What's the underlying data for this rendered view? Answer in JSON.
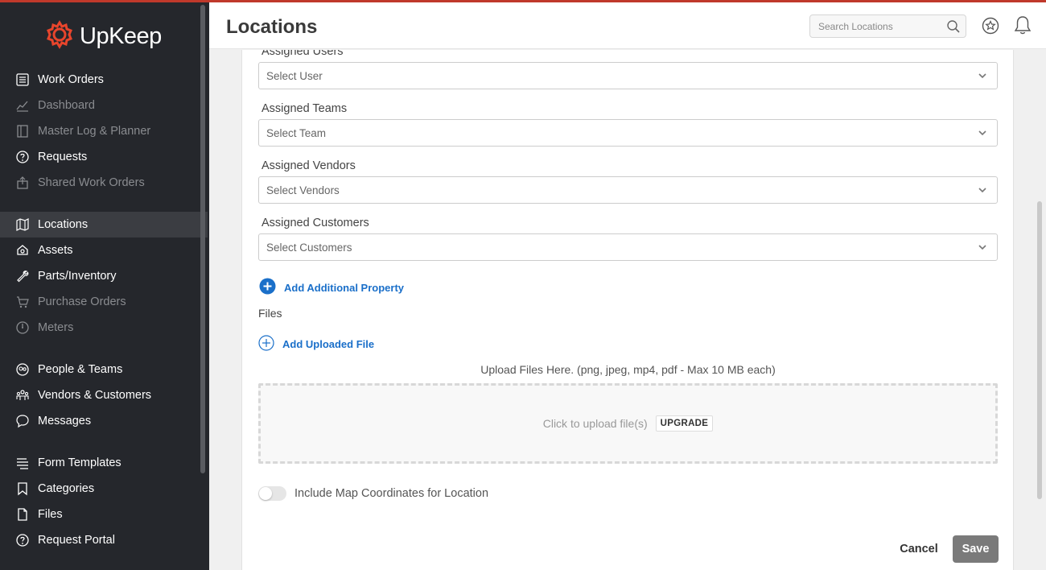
{
  "app": {
    "name": "UpKeep",
    "brand_color": "#e8452c"
  },
  "sidebar": {
    "groups": [
      [
        {
          "label": "Work Orders",
          "icon": "list-icon",
          "dim": false
        },
        {
          "label": "Dashboard",
          "icon": "chart-icon",
          "dim": true
        },
        {
          "label": "Master Log & Planner",
          "icon": "book-icon",
          "dim": true
        },
        {
          "label": "Requests",
          "icon": "question-icon",
          "dim": false
        },
        {
          "label": "Shared Work Orders",
          "icon": "share-icon",
          "dim": true
        }
      ],
      [
        {
          "label": "Locations",
          "icon": "map-icon",
          "dim": false,
          "active": true
        },
        {
          "label": "Assets",
          "icon": "asset-icon",
          "dim": false
        },
        {
          "label": "Parts/Inventory",
          "icon": "wrench-icon",
          "dim": false
        },
        {
          "label": "Purchase Orders",
          "icon": "cart-icon",
          "dim": true
        },
        {
          "label": "Meters",
          "icon": "meter-icon",
          "dim": true
        }
      ],
      [
        {
          "label": "People & Teams",
          "icon": "people-icon",
          "dim": false
        },
        {
          "label": "Vendors & Customers",
          "icon": "vendors-icon",
          "dim": false
        },
        {
          "label": "Messages",
          "icon": "chat-icon",
          "dim": false
        }
      ],
      [
        {
          "label": "Form Templates",
          "icon": "form-icon",
          "dim": false
        },
        {
          "label": "Categories",
          "icon": "bookmark-icon",
          "dim": false
        },
        {
          "label": "Files",
          "icon": "file-icon",
          "dim": false
        },
        {
          "label": "Request Portal",
          "icon": "portal-icon",
          "dim": false
        }
      ]
    ]
  },
  "header": {
    "title": "Locations",
    "search_placeholder": "Search Locations"
  },
  "form": {
    "assigned_users": {
      "label": "Assigned Users",
      "placeholder": "Select User"
    },
    "assigned_teams": {
      "label": "Assigned Teams",
      "placeholder": "Select Team"
    },
    "assigned_vendors": {
      "label": "Assigned Vendors",
      "placeholder": "Select Vendors"
    },
    "assigned_customers": {
      "label": "Assigned Customers",
      "placeholder": "Select Customers"
    },
    "add_property": "Add Additional Property",
    "files_label": "Files",
    "add_file": "Add Uploaded File",
    "upload_hint": "Upload Files Here. (png, jpeg, mp4, pdf - Max 10 MB each)",
    "dropzone_text": "Click to upload file(s)",
    "upgrade": "UPGRADE",
    "map_toggle_label": "Include Map Coordinates for Location",
    "map_toggle_on": false,
    "cancel": "Cancel",
    "save": "Save"
  }
}
